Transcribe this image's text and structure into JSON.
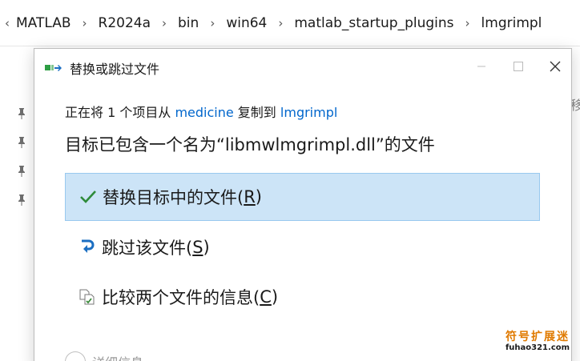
{
  "breadcrumb": {
    "items": [
      "MATLAB",
      "R2024a",
      "bin",
      "win64",
      "matlab_startup_plugins",
      "lmgrimpl"
    ]
  },
  "background": {
    "partial_text": "移"
  },
  "dialog": {
    "title": "替换或跳过文件",
    "source_prefix": "正在将 1 个项目从 ",
    "source_folder": "medicine",
    "copy_to": " 复制到 ",
    "dest_folder": "lmgrimpl",
    "headline": "目标已包含一个名为“libmwlmgrimpl.dll”的文件",
    "options": [
      {
        "label_main": "替换目标中的文件(",
        "hotkey": "R",
        "label_end": ")",
        "icon": "checkmark-icon",
        "color": "#2e8b3a"
      },
      {
        "label_main": "跳过该文件(",
        "hotkey": "S",
        "label_end": ")",
        "icon": "skip-arrow-icon",
        "color": "#1b6ec2"
      },
      {
        "label_main": "比较两个文件的信息(",
        "hotkey": "C",
        "label_end": ")",
        "icon": "compare-files-icon",
        "color": "#3a8a3a"
      }
    ],
    "details_label": "详细信息"
  },
  "watermark": {
    "top": "符号扩展迷",
    "bottom": "fuhao321.com"
  },
  "colors": {
    "selected_bg": "#cce4f7",
    "selected_border": "#99c9ef",
    "link": "#0066cc"
  }
}
